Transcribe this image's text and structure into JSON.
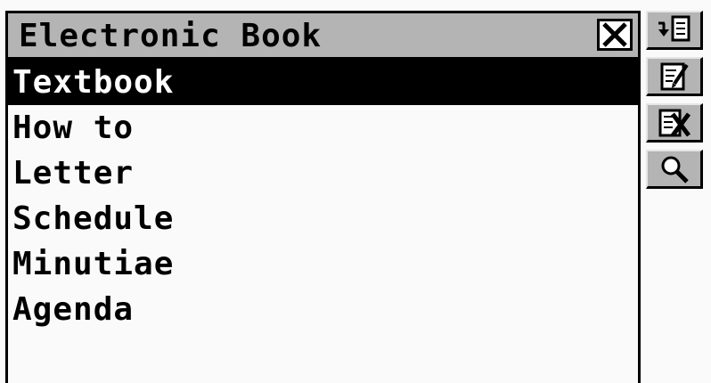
{
  "window": {
    "title": "Electronic Book"
  },
  "list": {
    "items": [
      {
        "label": "Textbook",
        "selected": true
      },
      {
        "label": "How to",
        "selected": false
      },
      {
        "label": "Letter",
        "selected": false
      },
      {
        "label": "Schedule",
        "selected": false
      },
      {
        "label": "Minutiae",
        "selected": false
      },
      {
        "label": "Agenda",
        "selected": false
      }
    ]
  },
  "toolbar": {
    "buttons": [
      {
        "icon": "open-document-icon"
      },
      {
        "icon": "edit-document-icon"
      },
      {
        "icon": "delete-document-icon"
      },
      {
        "icon": "search-icon"
      }
    ]
  },
  "colors": {
    "titlebar": "#b4b4b4",
    "selection": "#000000",
    "background": "#fafafa"
  }
}
